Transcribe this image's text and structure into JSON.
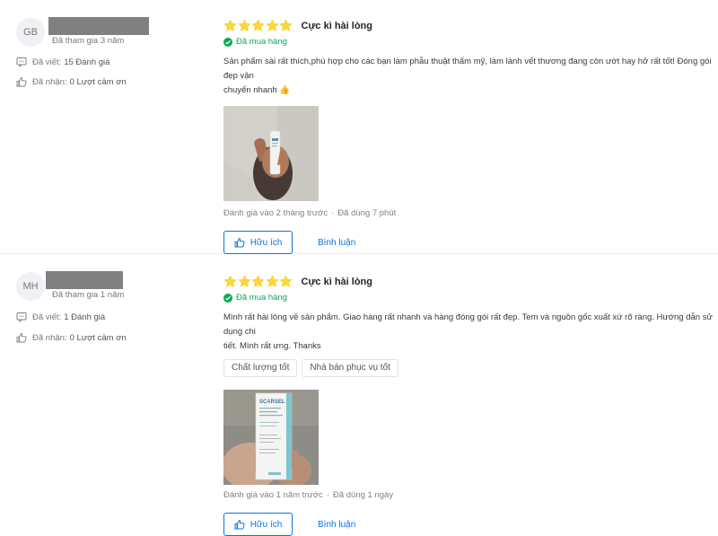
{
  "reviews": [
    {
      "avatar_initials": "GB",
      "joined": "Đã tham gia 3 năm",
      "written_label": "Đã viết:",
      "written_value": "15 Đánh giá",
      "received_label": "Đã nhận:",
      "received_value": "0 Lượt cảm ơn",
      "rating": 5,
      "rating_title": "Cực kì hài lòng",
      "bought_label": "Đã mua hàng",
      "content_line1": "Sản phẩm sài rất thích,phù hợp cho các bạn làm phẫu thuật thẩm mỹ, làm lành vết thương đang còn ướt hay hở rất tốt! Đóng gói đẹp vận",
      "content_line2": "chuyển nhanh 👍",
      "tags": [],
      "reviewed_at": "Đánh giá vào 2 tháng trước",
      "used_for": "Đã dùng 7 phút",
      "helpful_label": "Hữu ích",
      "comment_label": "Bình luận"
    },
    {
      "avatar_initials": "MH",
      "joined": "Đã tham gia 1 năm",
      "written_label": "Đã viết:",
      "written_value": "1 Đánh giá",
      "received_label": "Đã nhận:",
      "received_value": "0 Lượt cảm ơn",
      "rating": 5,
      "rating_title": "Cực kì hài lòng",
      "bought_label": "Đã mua hàng",
      "content_line1": "Mình rất hài lòng về sản phẩm. Giao hàng rất nhanh và hàng đóng gói rất đẹp. Tem và nguồn gốc xuất xứ rõ ràng. Hướng dẫn sử dụng chi",
      "content_line2": "tiết. Mình rất ưng. Thanks",
      "tags": [
        "Chất lượng tốt",
        "Nhà bán phục vụ tốt"
      ],
      "product_brand": "SCARSEL",
      "reviewed_at": "Đánh giá vào 1 năm trước",
      "used_for": "Đã dùng 1 ngày",
      "helpful_label": "Hữu ích",
      "comment_label": "Bình luận"
    }
  ],
  "colors": {
    "star": "#fdd836",
    "accent": "#0b74e5",
    "bought": "#00ab56",
    "name_redacted": "#808080"
  }
}
